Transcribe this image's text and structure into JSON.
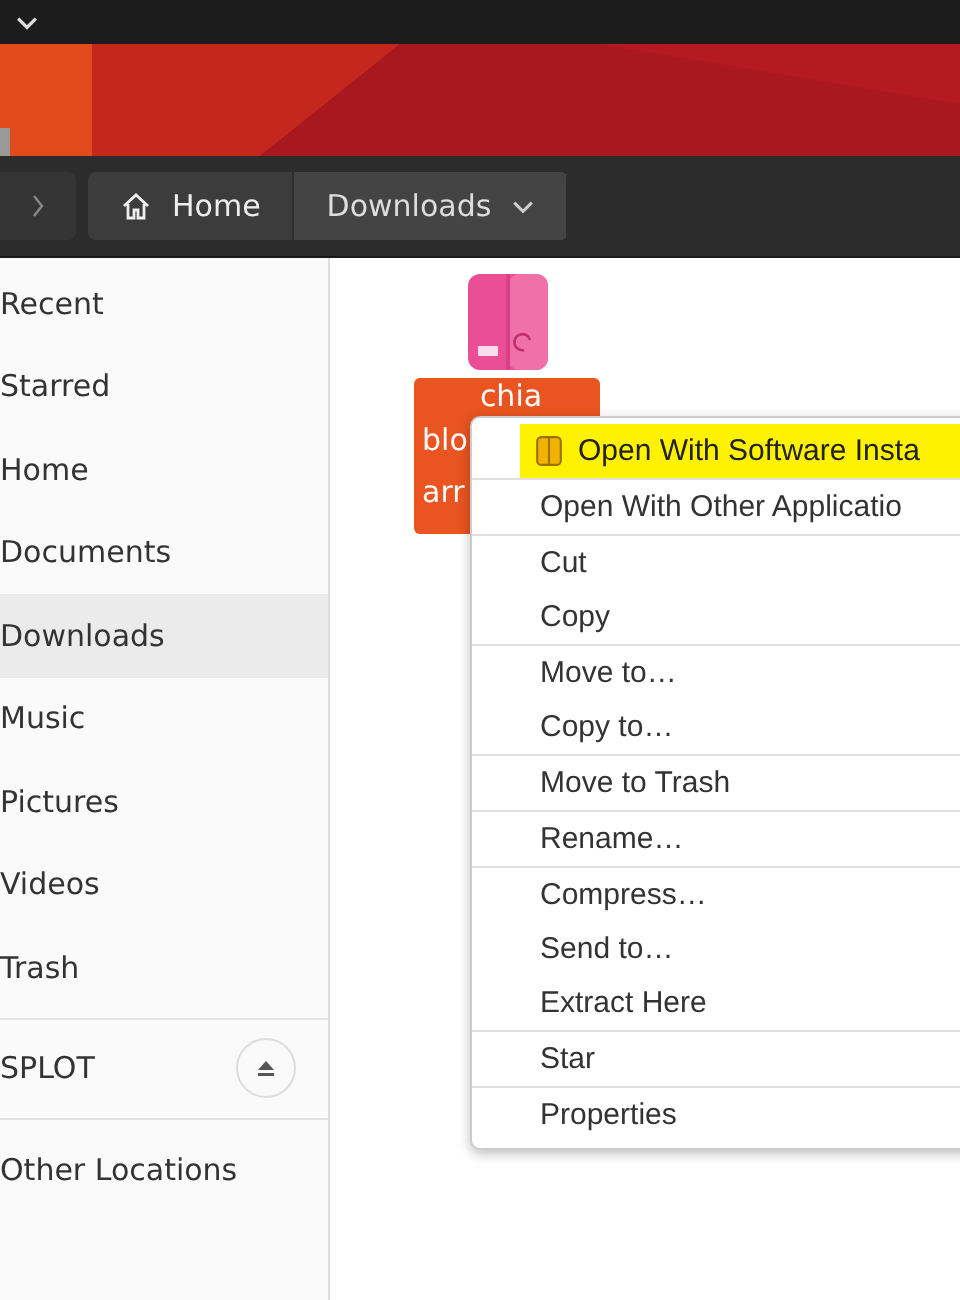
{
  "path_bar": {
    "crumbs": [
      {
        "label": "Home",
        "selected": false,
        "kind": "home"
      },
      {
        "label": "Downloads",
        "selected": true,
        "kind": "folder"
      }
    ]
  },
  "sidebar": {
    "items": [
      {
        "label": "Recent",
        "selected": false,
        "kind": "place"
      },
      {
        "label": "Starred",
        "selected": false,
        "kind": "place"
      },
      {
        "label": "Home",
        "selected": false,
        "kind": "place"
      },
      {
        "label": "Documents",
        "selected": false,
        "kind": "place"
      },
      {
        "label": "Downloads",
        "selected": true,
        "kind": "place"
      },
      {
        "label": "Music",
        "selected": false,
        "kind": "place"
      },
      {
        "label": "Pictures",
        "selected": false,
        "kind": "place"
      },
      {
        "label": "Videos",
        "selected": false,
        "kind": "place"
      },
      {
        "label": "Trash",
        "selected": false,
        "kind": "place"
      },
      {
        "label": "SPLOT",
        "selected": false,
        "kind": "drive"
      },
      {
        "label": "Other Locations",
        "selected": false,
        "kind": "other"
      }
    ]
  },
  "file": {
    "name_lines": [
      "chia",
      "blo",
      "arr"
    ],
    "selected": true
  },
  "context_menu": {
    "items": [
      {
        "label": "Open With Software Insta",
        "highlighted": true,
        "separator_after": true
      },
      {
        "label": "Open With Other Applicatio",
        "highlighted": false,
        "separator_after": true
      },
      {
        "label": "Cut",
        "highlighted": false,
        "separator_after": false
      },
      {
        "label": "Copy",
        "highlighted": false,
        "separator_after": true
      },
      {
        "label": "Move to…",
        "highlighted": false,
        "separator_after": false
      },
      {
        "label": "Copy to…",
        "highlighted": false,
        "separator_after": true
      },
      {
        "label": "Move to Trash",
        "highlighted": false,
        "separator_after": true
      },
      {
        "label": "Rename…",
        "highlighted": false,
        "separator_after": true
      },
      {
        "label": "Compress…",
        "highlighted": false,
        "separator_after": false
      },
      {
        "label": "Send to…",
        "highlighted": false,
        "separator_after": false
      },
      {
        "label": "Extract Here",
        "highlighted": false,
        "separator_after": true
      },
      {
        "label": "Star",
        "highlighted": false,
        "separator_after": true
      },
      {
        "label": "Properties",
        "highlighted": false,
        "separator_after": false
      }
    ]
  }
}
